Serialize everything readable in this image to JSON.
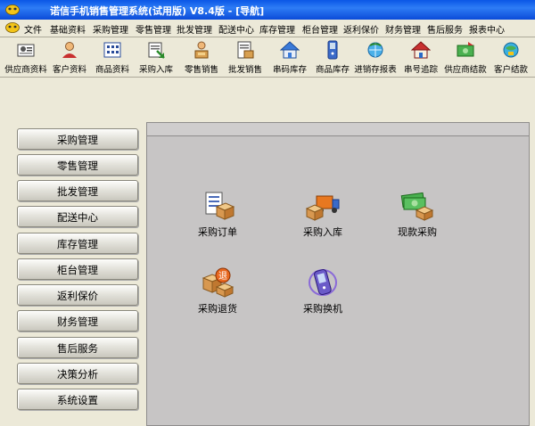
{
  "window": {
    "title": "诺信手机销售管理系统(试用版)  V8.4版 - [导航]"
  },
  "menu": [
    "文件",
    "基础资料",
    "采购管理",
    "零售管理",
    "批发管理",
    "配送中心",
    "库存管理",
    "柜台管理",
    "返利保价",
    "财务管理",
    "售后服务",
    "报表中心"
  ],
  "toolbar": [
    {
      "label": "供应商资料",
      "icon": "supplier-card-icon"
    },
    {
      "label": "客户资料",
      "icon": "customer-icon"
    },
    {
      "label": "商品资料",
      "icon": "product-grid-icon"
    },
    {
      "label": "采购入库",
      "icon": "purchase-in-icon"
    },
    {
      "label": "零售销售",
      "icon": "retail-sale-icon"
    },
    {
      "label": "批发销售",
      "icon": "wholesale-icon"
    },
    {
      "label": "串码库存",
      "icon": "house-icon"
    },
    {
      "label": "商品库存",
      "icon": "phone-stock-icon"
    },
    {
      "label": "进销存报表",
      "icon": "report-globe-icon"
    },
    {
      "label": "串号追踪",
      "icon": "tracking-house-icon"
    },
    {
      "label": "供应商结款",
      "icon": "supplier-payment-icon"
    },
    {
      "label": "客户结款",
      "icon": "customer-payment-icon"
    }
  ],
  "sidebar": [
    "采购管理",
    "零售管理",
    "批发管理",
    "配送中心",
    "库存管理",
    "柜台管理",
    "返利保价",
    "财务管理",
    "售后服务",
    "决策分析",
    "系统设置"
  ],
  "functions": [
    {
      "label": "采购订单",
      "icon": "purchase-order-icon"
    },
    {
      "label": "采购入库",
      "icon": "delivery-truck-icon"
    },
    {
      "label": "现款采购",
      "icon": "cash-purchase-icon"
    },
    {
      "label": "采购退货",
      "icon": "purchase-return-icon"
    },
    {
      "label": "采购换机",
      "icon": "phone-exchange-icon"
    }
  ],
  "colors": {
    "titlebar": "#0a56e6",
    "panel": "#c7c5c5",
    "window_bg": "#ece9d8"
  }
}
